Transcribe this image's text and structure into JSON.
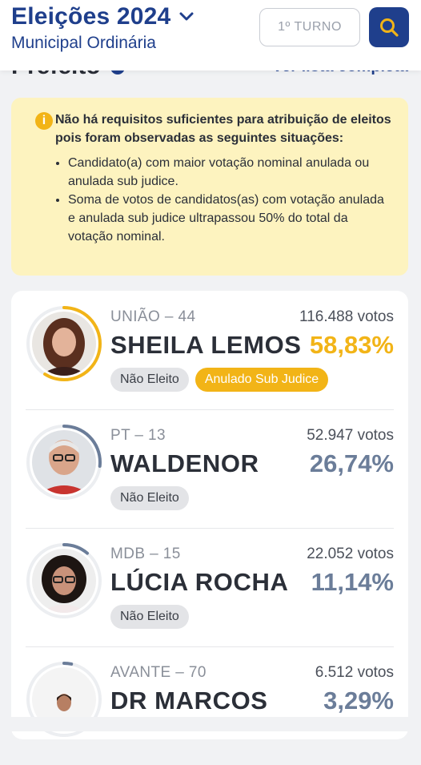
{
  "header": {
    "title": "Eleições 2024",
    "subtitle": "Municipal Ordinária",
    "turno": "1º TURNO",
    "icons": {
      "title_toggle": "chevron-down-icon",
      "search": "search-icon"
    }
  },
  "section": {
    "title": "Prefeito",
    "link": "Ver lista completa"
  },
  "alert": {
    "title": "Não há requisitos suficientes para atribuição de eleitos pois foram observadas as seguintes situações:",
    "items": [
      "Candidato(a) com maior votação nominal anulada ou anulada sub judice.",
      "Soma de votos de candidatos(as) com votação anulada e anulada sub judice ultrapassou 50% do total da votação nominal."
    ],
    "icon": "info-icon"
  },
  "candidates": [
    {
      "party": "UNIÃO – 44",
      "name": "SHEILA LEMOS",
      "votes": "116.488 votos",
      "pct": "58,83%",
      "share": 0.5883,
      "badge1": "Não Eleito",
      "badge2": "Anulado Sub Judice",
      "color": "#f2b417"
    },
    {
      "party": "PT – 13",
      "name": "WALDENOR",
      "votes": "52.947 votos",
      "pct": "26,74%",
      "share": 0.2674,
      "badge1": "Não Eleito",
      "color": "#6b7d99"
    },
    {
      "party": "MDB – 15",
      "name": "LÚCIA ROCHA",
      "votes": "22.052 votos",
      "pct": "11,14%",
      "share": 0.1114,
      "badge1": "Não Eleito",
      "color": "#6b7d99"
    },
    {
      "party": "AVANTE – 70",
      "name": "DR MARCOS",
      "votes": "6.512 votos",
      "pct": "3,29%",
      "share": 0.0329,
      "color": "#6b7d99"
    }
  ],
  "colors": {
    "brand": "#1f3f8c",
    "accent": "#f2b417",
    "alert_bg": "#fdf3bf"
  }
}
